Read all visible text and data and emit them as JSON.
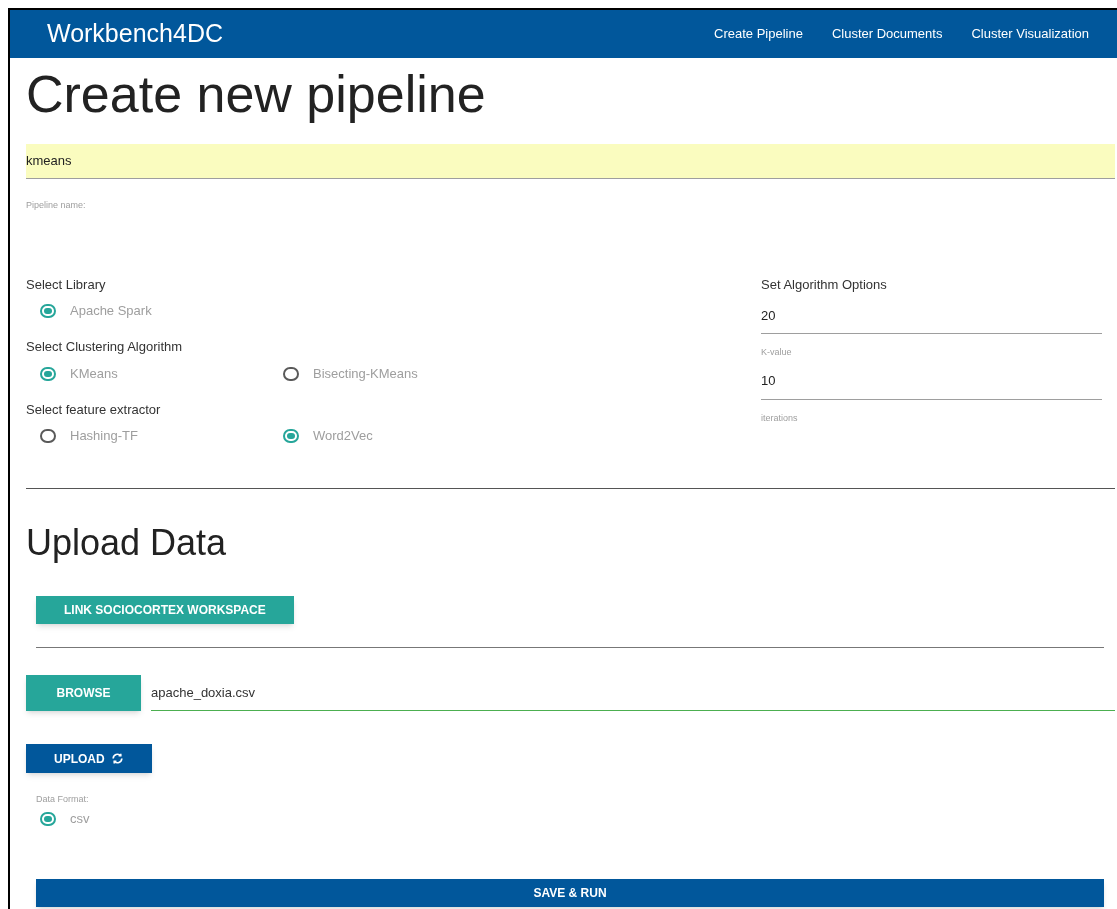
{
  "header": {
    "brand": "Workbench4DC",
    "nav": [
      {
        "label": "Create Pipeline"
      },
      {
        "label": "Cluster Documents"
      },
      {
        "label": "Cluster Visualization"
      }
    ]
  },
  "title": "Create new pipeline",
  "pipeline_name": {
    "value": "kmeans",
    "label": "Pipeline name:"
  },
  "radio_groups": [
    {
      "label": "Select Library",
      "options": [
        {
          "label": "Apache Spark",
          "selected": true
        }
      ]
    },
    {
      "label": "Select Clustering Algorithm",
      "options": [
        {
          "label": "KMeans",
          "selected": true
        },
        {
          "label": "Bisecting-KMeans",
          "selected": false
        }
      ]
    },
    {
      "label": "Select feature extractor",
      "options": [
        {
          "label": "Hashing-TF",
          "selected": false
        },
        {
          "label": "Word2Vec",
          "selected": true
        }
      ]
    }
  ],
  "algorithm_options": {
    "title": "Set Algorithm Options",
    "fields": [
      {
        "value": "20",
        "helper_text": "K-value"
      },
      {
        "value": "10",
        "helper_text": "iterations"
      }
    ]
  },
  "upload": {
    "title": "Upload Data",
    "link_button": "LINK SOCIOCORTEX WORKSPACE",
    "browse_button": "BROWSE",
    "file_name": "apache_doxia.csv",
    "upload_button": "UPLOAD",
    "format_label": "Data Format:",
    "formats": [
      {
        "label": "csv",
        "selected": true
      }
    ]
  },
  "save_button": "SAVE & RUN"
}
